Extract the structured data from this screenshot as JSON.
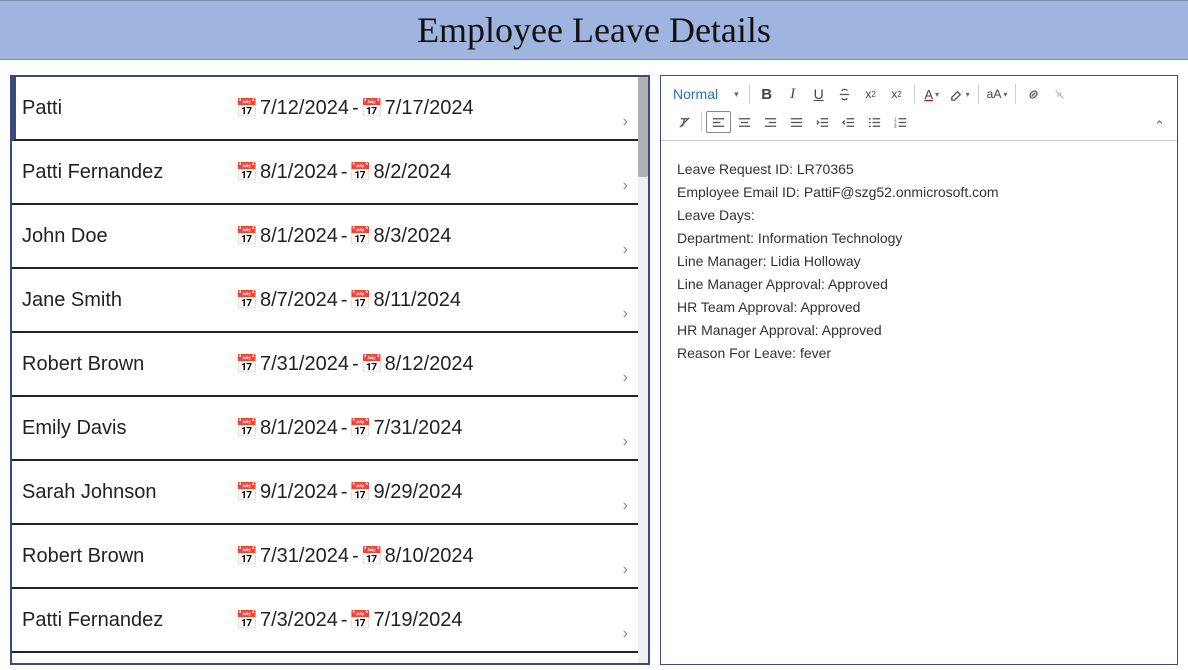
{
  "header": {
    "title": "Employee Leave Details"
  },
  "list": {
    "items": [
      {
        "name": "Patti",
        "start": "7/12/2024",
        "end": "7/17/2024",
        "selected": true
      },
      {
        "name": "Patti Fernandez",
        "start": "8/1/2024",
        "end": "8/2/2024",
        "selected": false
      },
      {
        "name": "John Doe",
        "start": "8/1/2024",
        "end": "8/3/2024",
        "selected": false
      },
      {
        "name": "Jane Smith",
        "start": "8/7/2024",
        "end": "8/11/2024",
        "selected": false
      },
      {
        "name": "Robert Brown",
        "start": "7/31/2024",
        "end": "8/12/2024",
        "selected": false
      },
      {
        "name": "Emily Davis",
        "start": "8/1/2024",
        "end": "7/31/2024",
        "selected": false
      },
      {
        "name": "Sarah Johnson",
        "start": "9/1/2024",
        "end": "9/29/2024",
        "selected": false
      },
      {
        "name": "Robert Brown",
        "start": "7/31/2024",
        "end": "8/10/2024",
        "selected": false
      },
      {
        "name": "Patti Fernandez",
        "start": "7/3/2024",
        "end": "7/19/2024",
        "selected": false
      }
    ],
    "dash": " - "
  },
  "toolbar": {
    "font_select": "Normal"
  },
  "detail": {
    "lines": [
      "Leave Request ID: LR70365",
      "Employee Email ID: PattiF@szg52.onmicrosoft.com",
      "Leave Days:",
      "Department: Information Technology",
      "Line Manager: Lidia Holloway",
      "Line Manager Approval: Approved",
      "HR Team Approval: Approved",
      "HR Manager Approval: Approved",
      "Reason For Leave: fever"
    ]
  }
}
